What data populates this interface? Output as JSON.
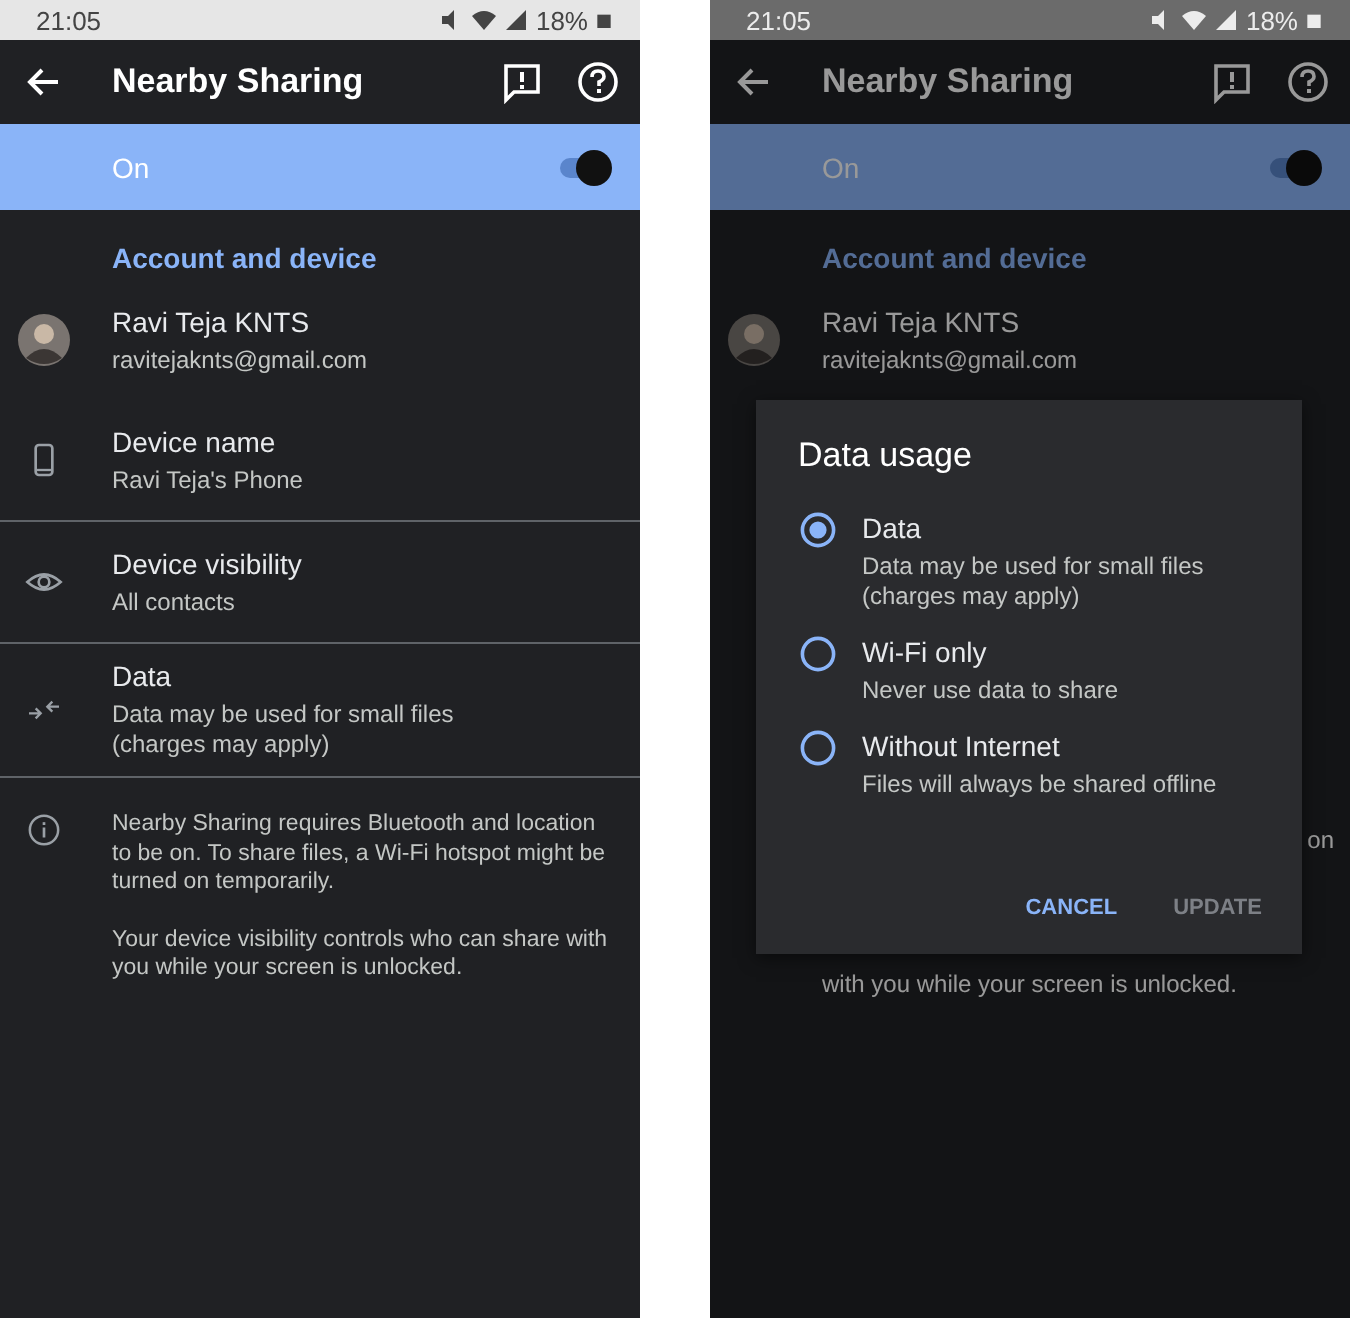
{
  "screens": [
    {
      "dimmed": false,
      "status_bar": {
        "time": "21:05",
        "battery": "18%"
      },
      "app_bar": {
        "title": "Nearby Sharing"
      },
      "master_switch": {
        "label": "On",
        "on": true
      },
      "section_header": "Account and device",
      "rows": [
        {
          "kind": "account",
          "title": "Ravi Teja KNTS",
          "lines": [
            "ravitejaknts@gmail.com"
          ]
        },
        {
          "kind": "device",
          "title": "Device name",
          "lines": [
            "Ravi Teja's Phone"
          ]
        },
        {
          "kind": "visibility",
          "title": "Device visibility",
          "lines": [
            "All contacts"
          ]
        },
        {
          "kind": "data",
          "title": "Data",
          "lines": [
            "Data may be used for small files",
            "(charges may apply)"
          ]
        }
      ],
      "info": [
        "Nearby Sharing requires Bluetooth and location to be on. To share files, a Wi-Fi hotspot might be turned on temporarily.",
        "Your device visibility controls who can share with you while your screen is unlocked."
      ]
    },
    {
      "dimmed": true,
      "status_bar": {
        "time": "21:05",
        "battery": "18%"
      },
      "app_bar": {
        "title": "Nearby Sharing"
      },
      "master_switch": {
        "label": "On",
        "on": true
      },
      "section_header": "Account and device",
      "rows": [
        {
          "kind": "account",
          "title": "Ravi Teja KNTS",
          "lines": [
            "ravitejaknts@gmail.com"
          ]
        }
      ],
      "fragments": [
        "on",
        "with you while your screen is unlocked."
      ],
      "dialog": {
        "title": "Data usage",
        "options": [
          {
            "label": "Data",
            "lines": [
              "Data may be used for small files",
              "(charges may apply)"
            ],
            "selected": true
          },
          {
            "label": "Wi-Fi only",
            "lines": [
              "Never use data to share"
            ],
            "selected": false
          },
          {
            "label": "Without Internet",
            "lines": [
              "Files will always be shared offline"
            ],
            "selected": false
          }
        ],
        "buttons": [
          {
            "label": "CANCEL",
            "disabled": false
          },
          {
            "label": "UPDATE",
            "disabled": true
          }
        ]
      }
    }
  ]
}
